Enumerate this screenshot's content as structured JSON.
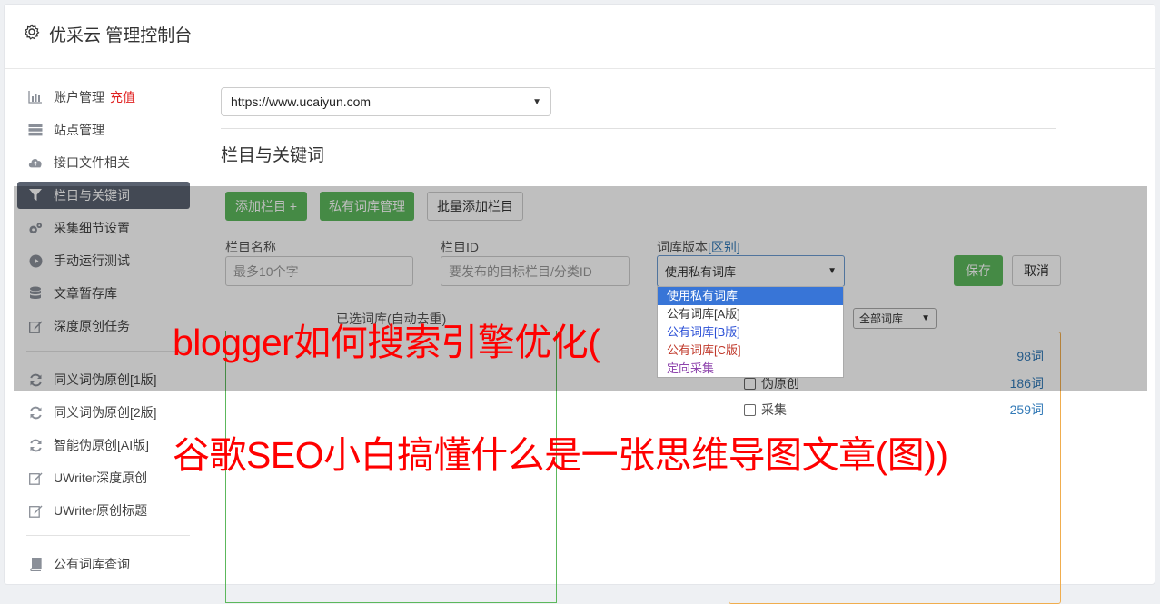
{
  "app": {
    "title": "优采云 管理控制台"
  },
  "sidebar": {
    "items": [
      {
        "label": "账户管理",
        "icon": "bar-chart-icon",
        "badge": "充值"
      },
      {
        "label": "站点管理",
        "icon": "server-icon"
      },
      {
        "label": "接口文件相关",
        "icon": "cloud-upload-icon"
      },
      {
        "label": "栏目与关键词",
        "icon": "filter-icon",
        "active": true
      },
      {
        "label": "采集细节设置",
        "icon": "gears-icon"
      },
      {
        "label": "手动运行测试",
        "icon": "play-circle-icon"
      },
      {
        "label": "文章暂存库",
        "icon": "database-icon"
      },
      {
        "label": "深度原创任务",
        "icon": "edit-icon"
      }
    ],
    "items2": [
      {
        "label": "同义词伪原创[1版]",
        "icon": "refresh-icon"
      },
      {
        "label": "同义词伪原创[2版]",
        "icon": "refresh-icon"
      },
      {
        "label": "智能伪原创[AI版]",
        "icon": "refresh-icon"
      },
      {
        "label": "UWriter深度原创",
        "icon": "edit-icon"
      },
      {
        "label": "UWriter原创标题",
        "icon": "edit-icon"
      }
    ],
    "items3": [
      {
        "label": "公有词库查询",
        "icon": "book-icon"
      }
    ]
  },
  "main": {
    "site_select": "https://www.ucaiyun.com",
    "section_title": "栏目与关键词",
    "buttons": {
      "add": "添加栏目 +",
      "private_lib": "私有词库管理",
      "batch_add": "批量添加栏目",
      "save": "保存",
      "cancel": "取消"
    },
    "fields": {
      "name_label": "栏目名称",
      "name_placeholder": "最多10个字",
      "id_label": "栏目ID",
      "id_placeholder": "要发布的目标栏目/分类ID",
      "version_label": "词库版本",
      "version_link": "[区别]",
      "version_value": "使用私有词库"
    },
    "dropdown_options": [
      {
        "label": "使用私有词库",
        "color": "#ffffff"
      },
      {
        "label": "公有词库[A版]",
        "color": "#333333"
      },
      {
        "label": "公有词库[B版]",
        "color": "#2a4fd6"
      },
      {
        "label": "公有词库[C版]",
        "color": "#c0392b"
      },
      {
        "label": "定向采集",
        "color": "#8e44ad"
      }
    ],
    "selected_label": "已选词库(自动去重)",
    "lib_filter": "全部词库",
    "libraries": [
      {
        "name": "",
        "count": "98词"
      },
      {
        "name": "伪原创",
        "count": "186词"
      },
      {
        "name": "采集",
        "count": "259词"
      }
    ]
  },
  "watermark": {
    "line1": "blogger如何搜索引擎优化(",
    "line2": "谷歌SEO小白搞懂什么是一张思维导图文章(图))"
  }
}
